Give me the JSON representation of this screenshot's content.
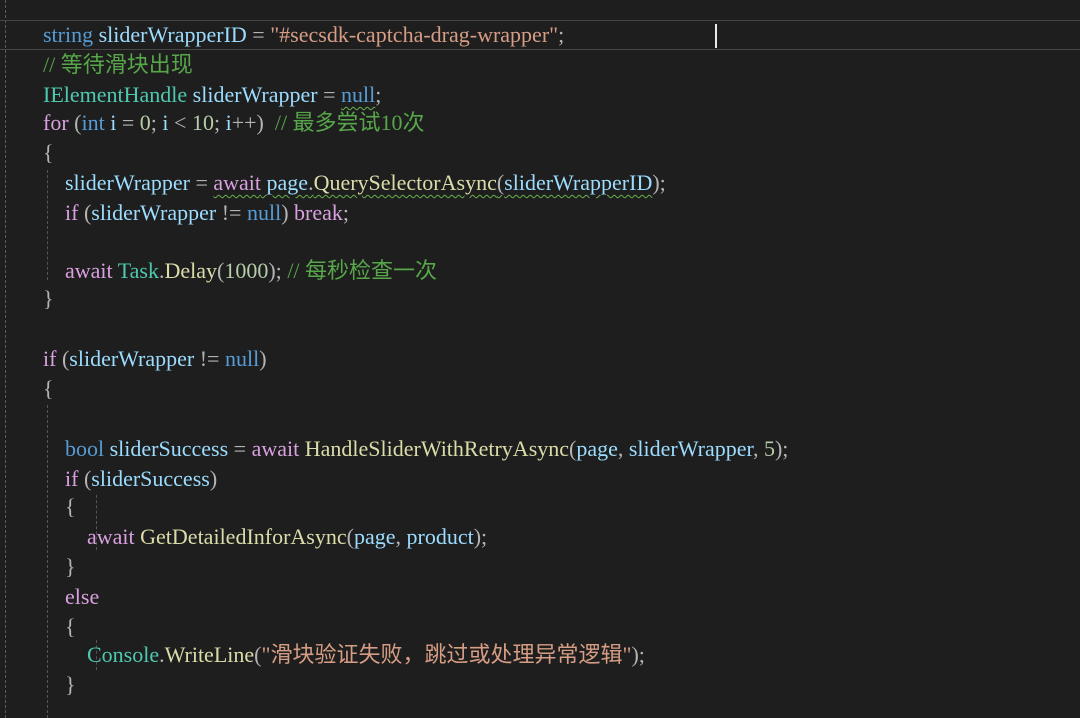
{
  "editor": {
    "lines": [
      {
        "id": "l1",
        "tokens": [
          [
            "kw",
            "string"
          ],
          [
            "plain",
            " "
          ],
          [
            "var",
            "sliderWrapperID"
          ],
          [
            "pun",
            " = "
          ],
          [
            "str",
            "\"#secsdk-captcha-drag-wrapper\""
          ],
          [
            "pun",
            ";"
          ]
        ]
      },
      {
        "id": "l2",
        "tokens": [
          [
            "cmt",
            "// 等待滑块出现"
          ]
        ]
      },
      {
        "id": "l3",
        "tokens": [
          [
            "ty",
            "IElementHandle"
          ],
          [
            "plain",
            " "
          ],
          [
            "var",
            "sliderWrapper"
          ],
          [
            "pun",
            " = "
          ],
          [
            "kw",
            "null"
          ],
          [
            "pun",
            ";"
          ]
        ]
      },
      {
        "id": "l4",
        "tokens": [
          [
            "ctl",
            "for"
          ],
          [
            "pun",
            " ("
          ],
          [
            "kw",
            "int"
          ],
          [
            "plain",
            " "
          ],
          [
            "var",
            "i"
          ],
          [
            "pun",
            " = "
          ],
          [
            "num",
            "0"
          ],
          [
            "pun",
            "; "
          ],
          [
            "var",
            "i"
          ],
          [
            "pun",
            " < "
          ],
          [
            "num",
            "10"
          ],
          [
            "pun",
            "; "
          ],
          [
            "var",
            "i"
          ],
          [
            "pun",
            "++)  "
          ],
          [
            "cmt",
            "// 最多尝试10次"
          ]
        ]
      },
      {
        "id": "l5",
        "tokens": [
          [
            "pun",
            "{"
          ]
        ]
      },
      {
        "id": "l6",
        "tokens": [
          [
            "plain",
            "    "
          ],
          [
            "var",
            "sliderWrapper"
          ],
          [
            "pun",
            " = "
          ],
          [
            "ctl",
            "await"
          ],
          [
            "plain",
            " "
          ],
          [
            "var",
            "page"
          ],
          [
            "pun",
            "."
          ],
          [
            "fn",
            "QuerySelectorAsync"
          ],
          [
            "pun",
            "("
          ],
          [
            "var",
            "sliderWrapperID"
          ],
          [
            "pun",
            ");"
          ]
        ]
      },
      {
        "id": "l7",
        "tokens": [
          [
            "plain",
            "    "
          ],
          [
            "ctl",
            "if"
          ],
          [
            "pun",
            " ("
          ],
          [
            "var",
            "sliderWrapper"
          ],
          [
            "pun",
            " != "
          ],
          [
            "kw",
            "null"
          ],
          [
            "pun",
            ") "
          ],
          [
            "ctl",
            "break"
          ],
          [
            "pun",
            ";"
          ]
        ]
      },
      {
        "id": "l8",
        "tokens": []
      },
      {
        "id": "l9",
        "tokens": [
          [
            "plain",
            "    "
          ],
          [
            "ctl",
            "await"
          ],
          [
            "plain",
            " "
          ],
          [
            "ty",
            "Task"
          ],
          [
            "pun",
            "."
          ],
          [
            "fn",
            "Delay"
          ],
          [
            "pun",
            "("
          ],
          [
            "num",
            "1000"
          ],
          [
            "pun",
            "); "
          ],
          [
            "cmt",
            "// 每秒检查一次"
          ]
        ]
      },
      {
        "id": "l10",
        "tokens": [
          [
            "pun",
            "}"
          ]
        ]
      },
      {
        "id": "l11",
        "tokens": []
      },
      {
        "id": "l12",
        "tokens": [
          [
            "ctl",
            "if"
          ],
          [
            "pun",
            " ("
          ],
          [
            "var",
            "sliderWrapper"
          ],
          [
            "pun",
            " != "
          ],
          [
            "kw",
            "null"
          ],
          [
            "pun",
            ")"
          ]
        ]
      },
      {
        "id": "l13",
        "tokens": [
          [
            "pun",
            "{"
          ]
        ]
      },
      {
        "id": "l14",
        "tokens": []
      },
      {
        "id": "l15",
        "tokens": [
          [
            "plain",
            "    "
          ],
          [
            "kw",
            "bool"
          ],
          [
            "plain",
            " "
          ],
          [
            "var",
            "sliderSuccess"
          ],
          [
            "pun",
            " = "
          ],
          [
            "ctl",
            "await"
          ],
          [
            "plain",
            " "
          ],
          [
            "fn",
            "HandleSliderWithRetryAsync"
          ],
          [
            "pun",
            "("
          ],
          [
            "var",
            "page"
          ],
          [
            "pun",
            ", "
          ],
          [
            "var",
            "sliderWrapper"
          ],
          [
            "pun",
            ", "
          ],
          [
            "num",
            "5"
          ],
          [
            "pun",
            ");"
          ]
        ]
      },
      {
        "id": "l16",
        "tokens": [
          [
            "plain",
            "    "
          ],
          [
            "ctl",
            "if"
          ],
          [
            "pun",
            " ("
          ],
          [
            "var",
            "sliderSuccess"
          ],
          [
            "pun",
            ")"
          ]
        ]
      },
      {
        "id": "l17",
        "tokens": [
          [
            "plain",
            "    "
          ],
          [
            "pun",
            "{"
          ]
        ]
      },
      {
        "id": "l18",
        "tokens": [
          [
            "plain",
            "        "
          ],
          [
            "ctl",
            "await"
          ],
          [
            "plain",
            " "
          ],
          [
            "fn",
            "GetDetailedInforAsync"
          ],
          [
            "pun",
            "("
          ],
          [
            "var",
            "page"
          ],
          [
            "pun",
            ", "
          ],
          [
            "var",
            "product"
          ],
          [
            "pun",
            ");"
          ]
        ]
      },
      {
        "id": "l19",
        "tokens": [
          [
            "plain",
            "    "
          ],
          [
            "pun",
            "}"
          ]
        ]
      },
      {
        "id": "l20",
        "tokens": [
          [
            "plain",
            "    "
          ],
          [
            "ctl",
            "else"
          ]
        ]
      },
      {
        "id": "l21",
        "tokens": [
          [
            "plain",
            "    "
          ],
          [
            "pun",
            "{"
          ]
        ]
      },
      {
        "id": "l22",
        "tokens": [
          [
            "plain",
            "        "
          ],
          [
            "ty",
            "Console"
          ],
          [
            "pun",
            "."
          ],
          [
            "fn",
            "WriteLine"
          ],
          [
            "pun",
            "("
          ],
          [
            "str",
            "\"滑块验证失败，跳过或处理异常逻辑\""
          ],
          [
            "pun",
            ");"
          ]
        ]
      },
      {
        "id": "l23",
        "tokens": [
          [
            "plain",
            "    "
          ],
          [
            "pun",
            "}"
          ]
        ]
      }
    ]
  }
}
